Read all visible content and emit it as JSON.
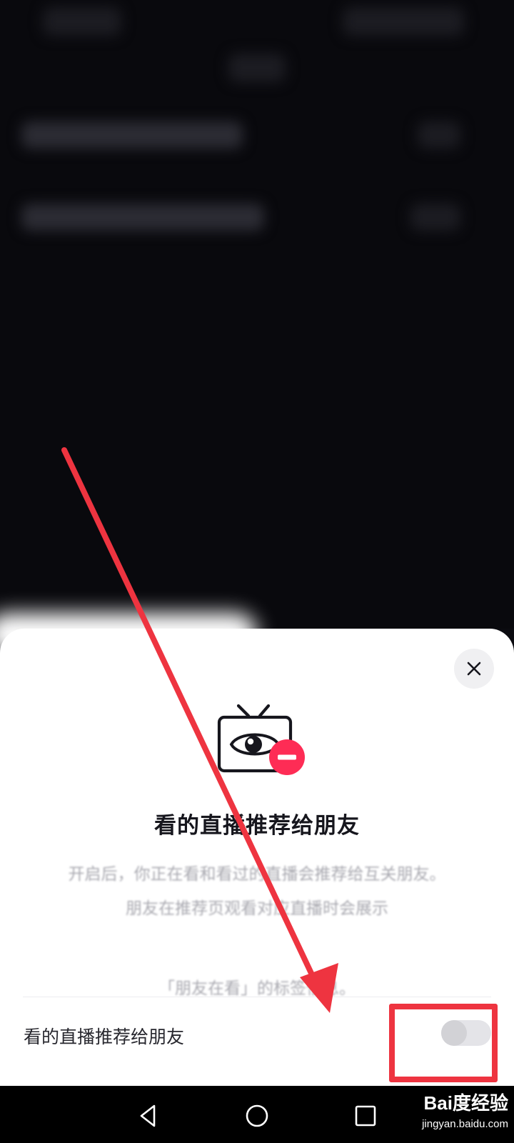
{
  "sheet": {
    "title": "看的直播推荐给朋友",
    "description": [
      "开启后，你正在看和看过的直播会推荐给互关朋友。",
      "朋友在推荐页观看对应直播时会展示",
      "「朋友在看」的标签信息。"
    ],
    "setting_label": "看的直播推荐给朋友",
    "toggle_state": "off"
  },
  "watermark": {
    "brand": "Bai度经验",
    "url": "jingyan.baidu.com"
  },
  "colors": {
    "sheet_bg": "#ffffff",
    "accent_red": "#fe2c55",
    "annotation_red": "#ee3440",
    "text_primary": "#16161d",
    "background": "#09090d"
  },
  "icons": {
    "close": "close-icon",
    "hero": "tv-eye-minus-icon",
    "nav_back": "nav-back-icon",
    "nav_home": "nav-home-icon",
    "nav_recents": "nav-recents-icon"
  }
}
